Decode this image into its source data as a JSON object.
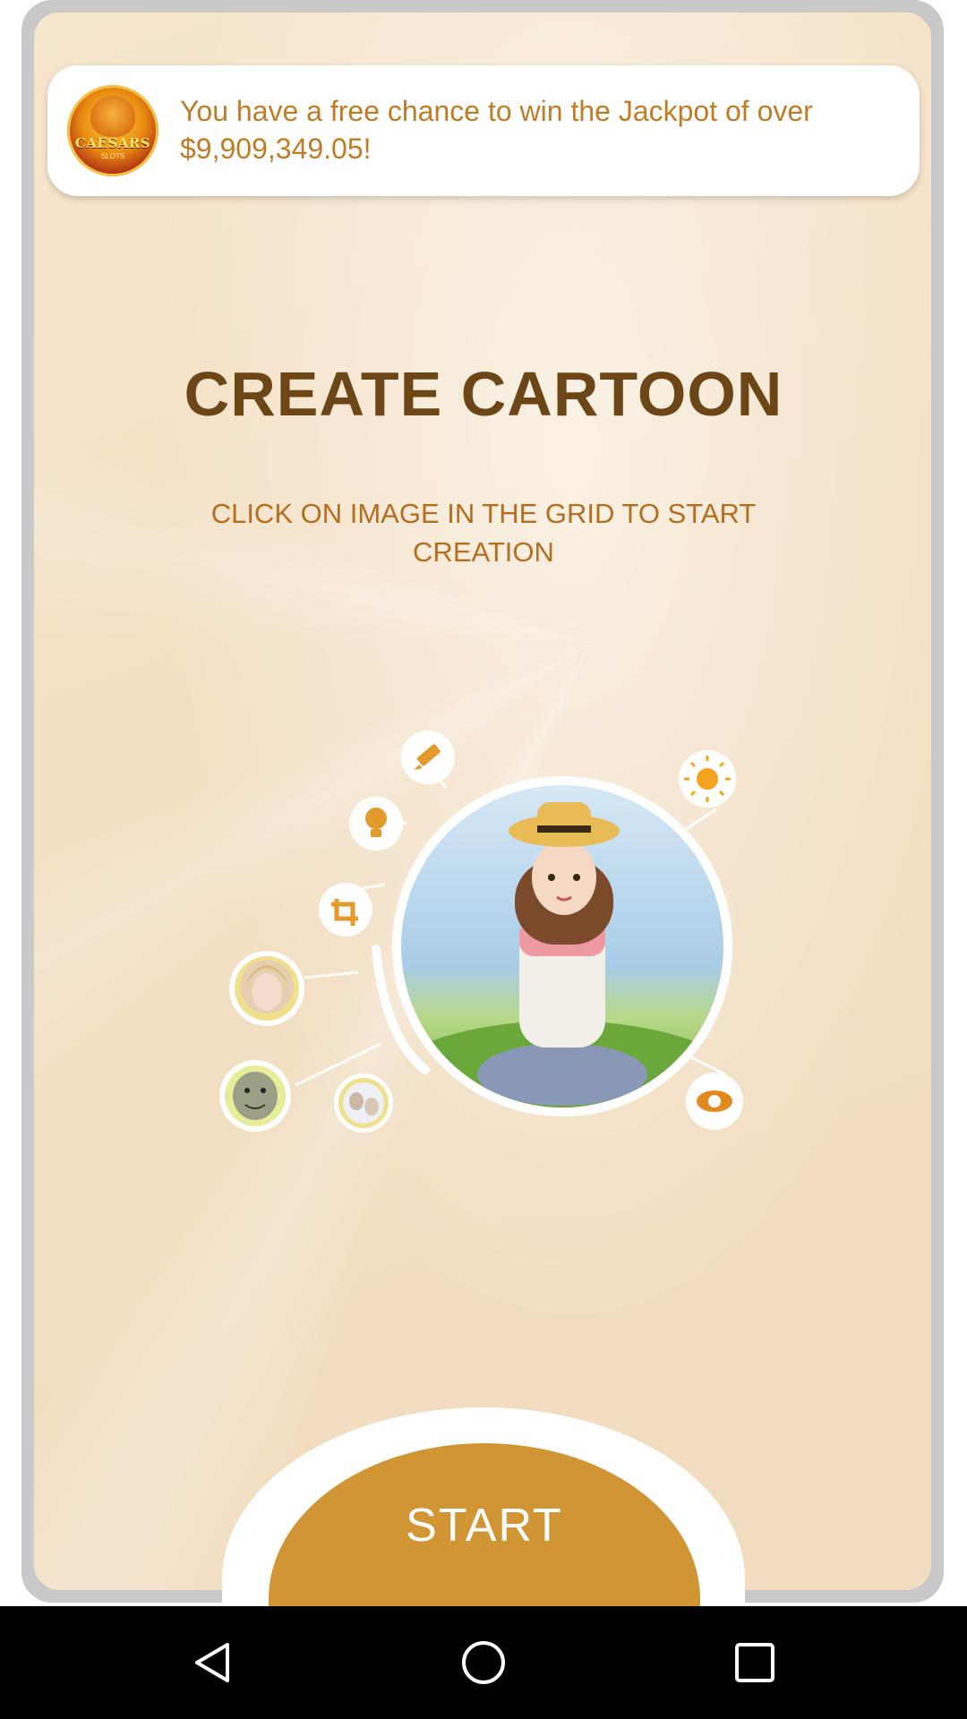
{
  "ad": {
    "logo_text": "CAESARS",
    "logo_subtext": "SLOTS",
    "message": "You have a free chance to win the Jackpot of over $9,909,349.05!"
  },
  "main": {
    "title": "CREATE CARTOON",
    "instruction": "CLICK ON IMAGE IN THE GRID TO START CREATION",
    "start_label": "START"
  },
  "illustration": {
    "tools": [
      "pencil-icon",
      "lightbulb-icon",
      "crop-icon",
      "sun-icon",
      "eye-icon"
    ],
    "avatars": [
      "avatar-blonde-woman",
      "avatar-ogre",
      "avatar-couple"
    ]
  },
  "navbar": {
    "buttons": [
      "back-icon",
      "home-icon",
      "recents-icon"
    ]
  },
  "colors": {
    "accent": "#d19534",
    "title": "#6d4617",
    "subtitle": "#b46e1f",
    "ad_text": "#c07c25"
  }
}
